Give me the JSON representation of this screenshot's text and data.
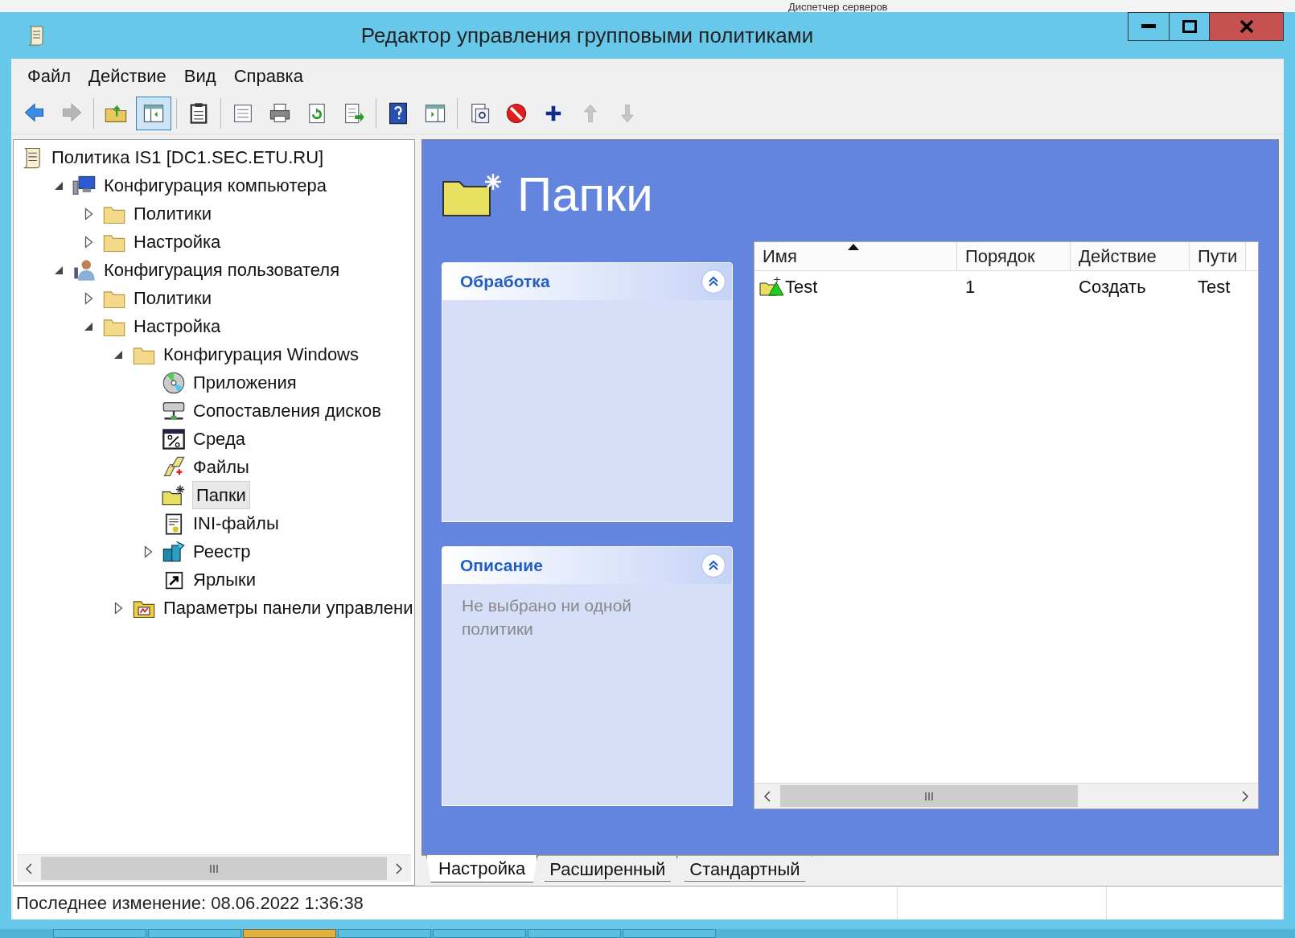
{
  "background_window": {
    "title": "Диспетчер серверов"
  },
  "window": {
    "title": "Редактор управления групповыми политиками"
  },
  "menu": [
    "Файл",
    "Действие",
    "Вид",
    "Справка"
  ],
  "toolbar": [
    {
      "disabled": false,
      "selected": false
    },
    {
      "disabled": true,
      "selected": false
    },
    {
      "disabled": false,
      "selected": false
    },
    {
      "disabled": false,
      "selected": true
    },
    {
      "disabled": false,
      "selected": false
    },
    {
      "disabled": false,
      "selected": false
    },
    {
      "disabled": false,
      "selected": false
    },
    {
      "disabled": false,
      "selected": false
    },
    {
      "disabled": false,
      "selected": false
    },
    {
      "disabled": false,
      "selected": false
    },
    {
      "disabled": false,
      "selected": false
    },
    {
      "disabled": false,
      "selected": false
    },
    {
      "disabled": false,
      "selected": false
    },
    {
      "disabled": false,
      "selected": false
    },
    {
      "disabled": true,
      "selected": false
    },
    {
      "disabled": true,
      "selected": false
    }
  ],
  "tree": [
    {
      "label": "Политика IS1 [DC1.SEC.ETU.RU]",
      "kind": "policy",
      "selected": false,
      "children": [
        {
          "label": "Конфигурация компьютера",
          "kind": "computer",
          "expanded": true,
          "selected": false,
          "children": [
            {
              "label": "Политики",
              "kind": "folder",
              "expanded": false,
              "selected": false
            },
            {
              "label": "Настройка",
              "kind": "folder",
              "expanded": false,
              "selected": false
            }
          ]
        },
        {
          "label": "Конфигурация пользователя",
          "kind": "user",
          "expanded": true,
          "selected": false,
          "children": [
            {
              "label": "Политики",
              "kind": "folder",
              "expanded": false,
              "selected": false
            },
            {
              "label": "Настройка",
              "kind": "folder",
              "expanded": true,
              "selected": false,
              "children": [
                {
                  "label": "Конфигурация Windows",
                  "kind": "folder",
                  "expanded": true,
                  "selected": false,
                  "children": [
                    {
                      "label": "Приложения",
                      "kind": "disc",
                      "selected": false
                    },
                    {
                      "label": "Сопоставления дисков",
                      "kind": "drive",
                      "selected": false
                    },
                    {
                      "label": "Среда",
                      "kind": "environment",
                      "selected": false
                    },
                    {
                      "label": "Файлы",
                      "kind": "files",
                      "selected": false
                    },
                    {
                      "label": "Папки",
                      "kind": "newfolder",
                      "selected": true
                    },
                    {
                      "label": "INI-файлы",
                      "kind": "ini",
                      "selected": false
                    },
                    {
                      "label": "Реестр",
                      "kind": "registry",
                      "expanded": false,
                      "selected": false
                    },
                    {
                      "label": "Ярлыки",
                      "kind": "shortcut",
                      "selected": false
                    }
                  ]
                },
                {
                  "label": "Параметры панели управлени",
                  "kind": "controlpanel",
                  "expanded": false,
                  "selected": false
                }
              ]
            }
          ]
        }
      ]
    }
  ],
  "details": {
    "title": "Папки",
    "panels": [
      {
        "title": "Обработка",
        "expanded": true
      },
      {
        "title": "Описание",
        "expanded": true,
        "text": "Не выбрано ни одной политики"
      }
    ],
    "list": {
      "columns": [
        {
          "label": "Имя",
          "sort_ascending": true
        },
        {
          "label": "Порядок"
        },
        {
          "label": "Действие"
        },
        {
          "label": "Пути"
        }
      ],
      "rows": [
        {
          "cells": [
            "Test",
            "1",
            "Создать",
            "Test"
          ]
        }
      ]
    }
  },
  "tabs": [
    {
      "label": "Настройка",
      "selected": true
    },
    {
      "label": "Расширенный",
      "selected": false
    },
    {
      "label": "Стандартный",
      "selected": false
    }
  ],
  "status_bar": {
    "text": "Последнее изменение: 08.06.2022 1:36:38"
  },
  "taskbar": [
    {
      "selected": false
    },
    {
      "selected": false
    },
    {
      "selected": true
    },
    {
      "selected": false
    },
    {
      "selected": false
    },
    {
      "selected": false
    },
    {
      "selected": false
    }
  ]
}
